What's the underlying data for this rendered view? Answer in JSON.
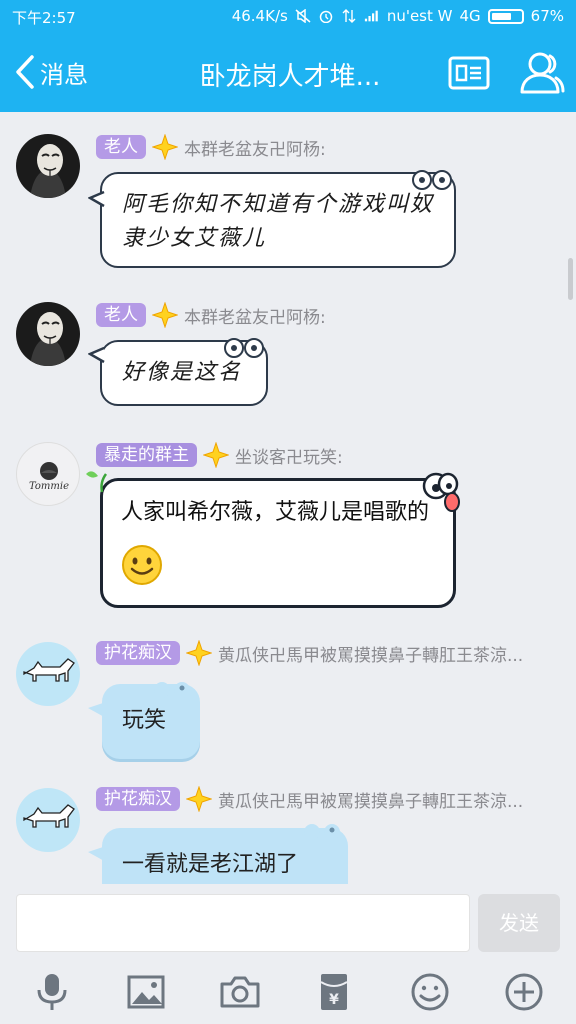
{
  "status_bar": {
    "time": "下午2:57",
    "speed": "46.4K/s",
    "carrier": "nu'est W",
    "network": "4G",
    "battery": "67%",
    "battery_level": 0.67
  },
  "nav": {
    "back_label": "消息",
    "title": "卧龙岗人才堆...",
    "card_icon": "id-card-icon",
    "profile_icon": "group-members-icon"
  },
  "messages": [
    {
      "badge": "老人",
      "nickname": "本群老盆友卍阿杨:",
      "text": "阿毛你知不知道有个游戏叫奴隶少女艾薇儿",
      "style": "handwriting-white"
    },
    {
      "badge": "老人",
      "nickname": "本群老盆友卍阿杨:",
      "text": "好像是这名",
      "style": "handwriting-white"
    },
    {
      "badge": "暴走的群主",
      "nickname": "坐谈客卍玩笑:",
      "text": "人家叫希尔薇，艾薇儿是唱歌的",
      "avatar_text": "Tommie",
      "style": "bold-white"
    },
    {
      "badge": "护花痴汉",
      "nickname": "黄瓜侠卍馬甲被罵摸摸鼻子轉肛王茶涼...",
      "text": "玩笑",
      "style": "blue-hippo"
    },
    {
      "badge": "护花痴汉",
      "nickname": "黄瓜侠卍馬甲被罵摸摸鼻子轉肛王茶涼...",
      "text": "一看就是老江湖了",
      "style": "blue-hippo"
    }
  ],
  "input": {
    "placeholder": "",
    "send_label": "发送"
  },
  "toolbar": {
    "items": [
      "microphone-icon",
      "image-icon",
      "camera-icon",
      "red-packet-icon",
      "emoji-icon",
      "plus-icon"
    ],
    "red_packet_symbol": "¥"
  },
  "colors": {
    "header": "#1eb3f2",
    "badge": "#b49ae6",
    "blue_bubble": "#bfe3f7",
    "background": "#eceef2"
  }
}
